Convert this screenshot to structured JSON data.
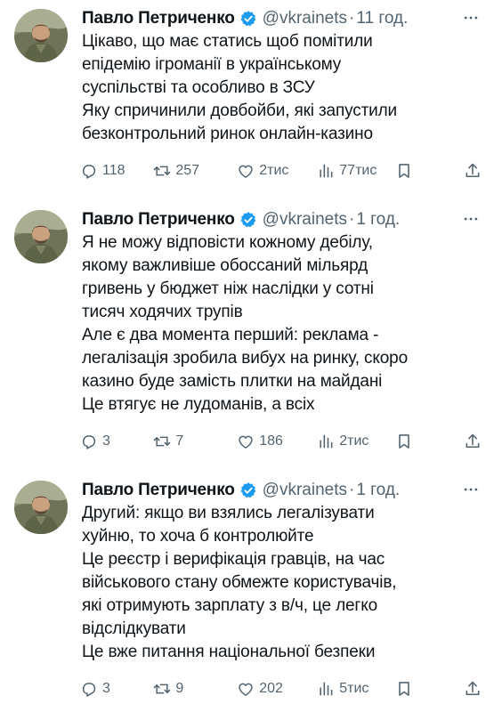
{
  "tweets": [
    {
      "author": "Павло Петриченко",
      "handle": "@vkrainets",
      "separator": "·",
      "time": "11 год.",
      "lines": [
        "Цікаво, що має статись щоб помітили",
        "епідемію ігроманії в українському",
        "суспільстві та особливо в ЗСУ",
        "Яку спричинили довбойби, які запустили",
        "безконтрольний ринок онлайн-казино"
      ],
      "replies": "118",
      "retweets": "257",
      "likes": "2тис",
      "views": "77тис"
    },
    {
      "author": "Павло Петриченко",
      "handle": "@vkrainets",
      "separator": "·",
      "time": "1 год.",
      "lines": [
        "Я не можу відповісти кожному дебілу,",
        "якому важливіше обоссаний мільярд",
        "гривень у бюджет ніж наслідки у сотні",
        "тисяч ходячих трупів",
        "Але є два момента перший: реклама -",
        "легалізація зробила вибух на ринку, скоро",
        "казино буде замість плитки на майдані",
        "Це втягує не лудоманів, а всіх"
      ],
      "replies": "3",
      "retweets": "7",
      "likes": "186",
      "views": "2тис"
    },
    {
      "author": "Павло Петриченко",
      "handle": "@vkrainets",
      "separator": "·",
      "time": "1 год.",
      "lines": [
        "Другий: якщо ви взялись легалізувати",
        "хуйню, то хоча б контролюйте",
        "Це реєстр і верифікація гравців, на час",
        "військового стану обмежте користувачів,",
        "які отримують зарплату з в/ч, це легко",
        "відслідкувати",
        "Це вже питання національної безпеки"
      ],
      "replies": "3",
      "retweets": "9",
      "likes": "202",
      "views": "5тис"
    }
  ],
  "colors": {
    "text": "#0f1419",
    "secondary": "#536471",
    "verified": "#1d9bf0"
  },
  "icons": [
    "verified-badge-icon",
    "more-icon",
    "reply-icon",
    "retweet-icon",
    "like-icon",
    "views-icon",
    "bookmark-icon",
    "share-icon"
  ]
}
